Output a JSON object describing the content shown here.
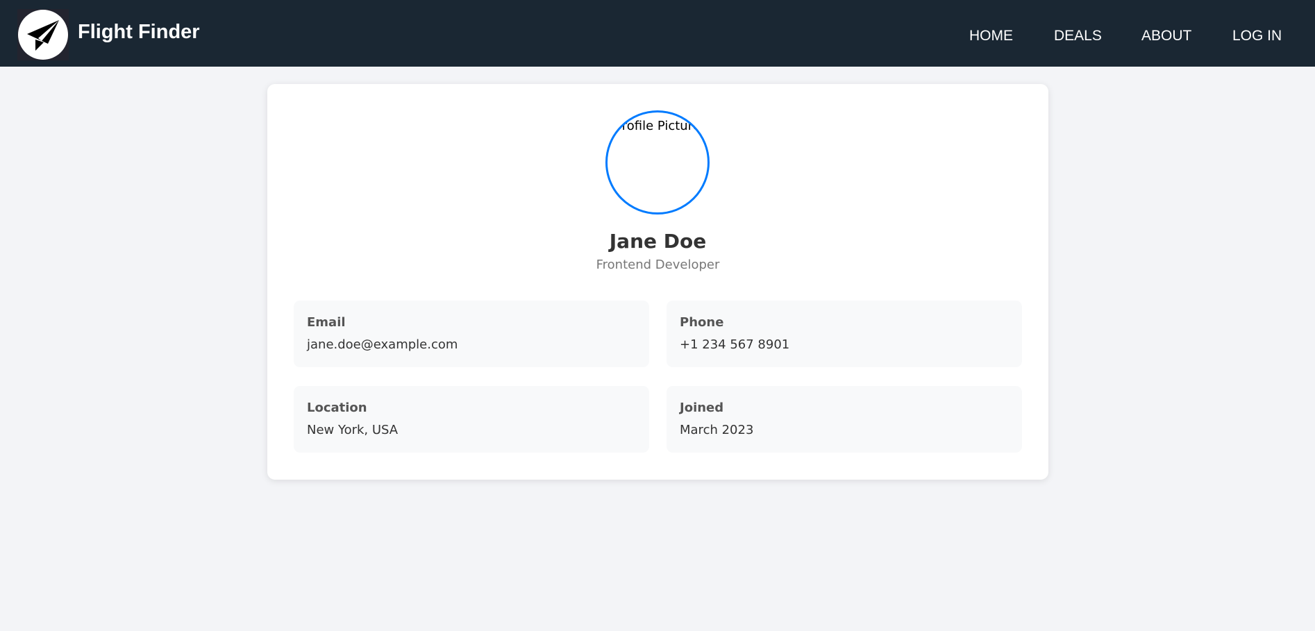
{
  "header": {
    "brand": "Flight Finder",
    "nav": [
      "HOME",
      "DEALS",
      "ABOUT",
      "LOG IN"
    ]
  },
  "profile": {
    "avatar_alt": "Profile Picture",
    "name": "Jane Doe",
    "role": "Frontend Developer",
    "accent": "#007bff"
  },
  "info": [
    {
      "label": "Email",
      "value": "jane.doe@example.com"
    },
    {
      "label": "Phone",
      "value": "+1 234 567 8901"
    },
    {
      "label": "Location",
      "value": "New York, USA"
    },
    {
      "label": "Joined",
      "value": "March 2023"
    }
  ]
}
